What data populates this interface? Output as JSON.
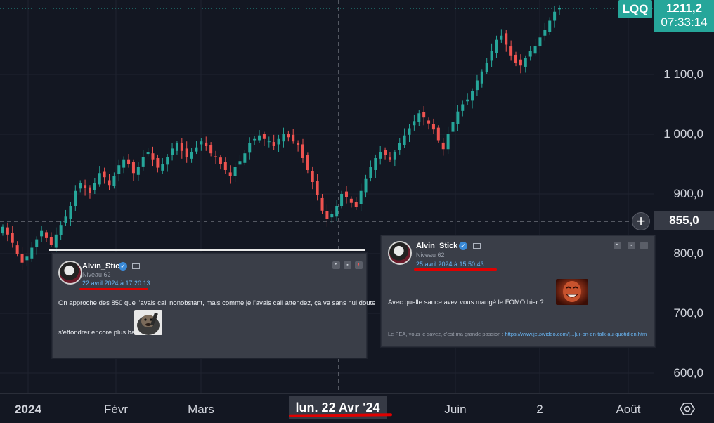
{
  "symbol": "LQQ",
  "last_price": "1211,2",
  "countdown": "07:33:14",
  "crosshair_price": "855,0",
  "crosshair_date": "lun. 22 Avr '24",
  "price_ticks": [
    "1 100,0",
    "1 000,0",
    "900,0",
    "800,0",
    "700,0",
    "600,0"
  ],
  "time_ticks": [
    "2024",
    "Févr",
    "Mars",
    "Juin",
    "2",
    "Août"
  ],
  "colors": {
    "up": "#26a69a",
    "down": "#ef5350",
    "bg": "#131722",
    "accent_red": "#e00000"
  },
  "posts": [
    {
      "author": "Alvin_Stick",
      "level": "Niveau 62",
      "date": "22 avril 2024 à 17:20:13",
      "text_line1": "On approche des 850 que j'avais call nonobstant, mais comme je l'avais call attendez, ça va sans nul doute",
      "text_line2": "s'effondrer encore plus bas",
      "sticker": "monkey-sticker"
    },
    {
      "author": "Alvin_Stick",
      "level": "Niveau 62",
      "date": "25 avril 2024 à 15:50:43",
      "text": "Avec quelle sauce avez vous mangé le FOMO hier ?",
      "sticker": "laughing-face-sticker",
      "signature_prefix": "Le PEA, vous le savez, c'est ma grande passion : ",
      "signature_link": "https://www.jeuxvideo.com/[...]ur-on-en-talk-au-quotidien.htm"
    }
  ],
  "post_actions": [
    "quote",
    "edit",
    "report"
  ],
  "chart_data": {
    "type": "candlestick",
    "last": 1211.2,
    "crosshair": {
      "price": 855.0,
      "date": "lun. 22 Avr '24"
    },
    "ylim": [
      560,
      1230
    ],
    "closes": [
      845,
      832,
      818,
      800,
      785,
      795,
      810,
      824,
      838,
      826,
      815,
      832,
      848,
      862,
      880,
      905,
      918,
      910,
      902,
      918,
      935,
      928,
      915,
      930,
      948,
      958,
      950,
      935,
      945,
      962,
      970,
      958,
      944,
      950,
      962,
      976,
      985,
      972,
      962,
      970,
      978,
      988,
      980,
      968,
      962,
      950,
      940,
      930,
      945,
      955,
      968,
      985,
      992,
      998,
      992,
      988,
      980,
      992,
      1000,
      995,
      988,
      982,
      960,
      940,
      920,
      898,
      872,
      858,
      866,
      880,
      900,
      895,
      885,
      878,
      905,
      925,
      945,
      960,
      970,
      965,
      958,
      970,
      985,
      998,
      1010,
      1022,
      1035,
      1028,
      1018,
      1008,
      990,
      975,
      1000,
      1020,
      1038,
      1050,
      1058,
      1072,
      1090,
      1105,
      1120,
      1140,
      1158,
      1165,
      1150,
      1132,
      1120,
      1115,
      1128,
      1140,
      1148,
      1162,
      1175,
      1190,
      1205,
      1211
    ]
  }
}
